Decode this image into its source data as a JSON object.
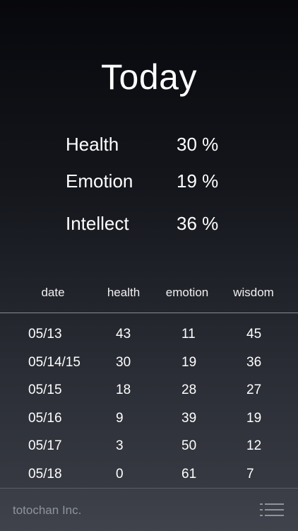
{
  "title": "Today",
  "stats": {
    "health": {
      "label": "Health",
      "value": "30 %"
    },
    "emotion": {
      "label": "Emotion",
      "value": "19 %"
    },
    "intellect": {
      "label": "Intellect",
      "value": "36 %"
    }
  },
  "table": {
    "headers": [
      "date",
      "health",
      "emotion",
      "wisdom"
    ],
    "rows": [
      {
        "date": "05/13",
        "health": "43",
        "emotion": "11",
        "wisdom": "45"
      },
      {
        "date": "05/14/15",
        "health": "30",
        "emotion": "19",
        "wisdom": "36"
      },
      {
        "date": "05/15",
        "health": "18",
        "emotion": "28",
        "wisdom": "27"
      },
      {
        "date": "05/16",
        "health": "9",
        "emotion": "39",
        "wisdom": "19"
      },
      {
        "date": "05/17",
        "health": "3",
        "emotion": "50",
        "wisdom": "12"
      },
      {
        "date": "05/18",
        "health": "0",
        "emotion": "61",
        "wisdom": "7"
      }
    ]
  },
  "footer": {
    "brand": "totochan Inc.",
    "menu_icon": "list-menu-icon"
  },
  "colors": {
    "text": "#ffffff",
    "muted": "#8f939a",
    "divider": "#8a8d94"
  }
}
